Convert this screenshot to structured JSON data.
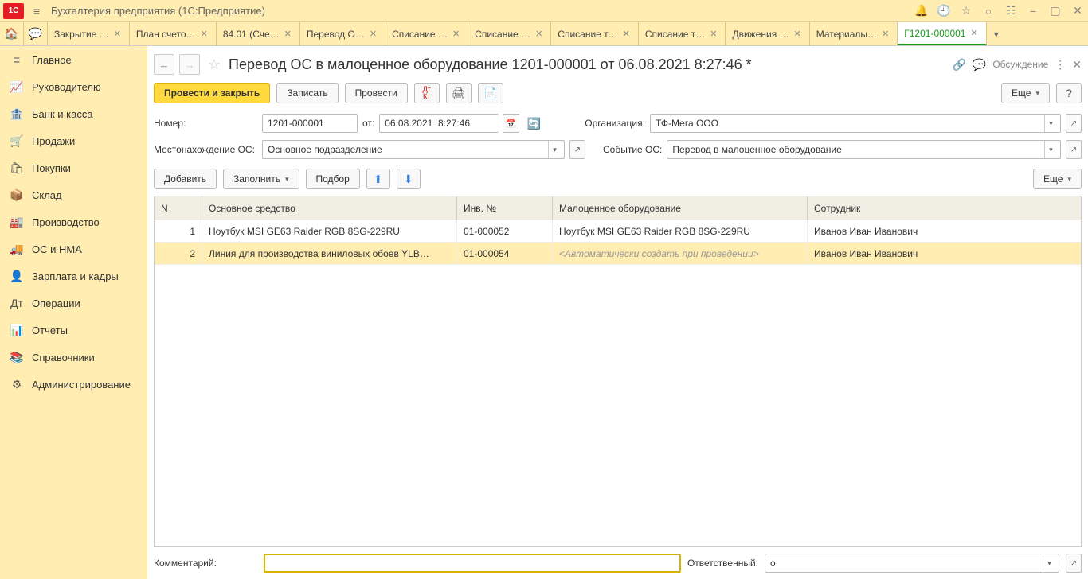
{
  "titlebar": {
    "app_title": "Бухгалтерия предприятия  (1С:Предприятие)"
  },
  "tabs": [
    {
      "label": "Закрытие …"
    },
    {
      "label": "План счето…"
    },
    {
      "label": "84.01 (Сче…"
    },
    {
      "label": "Перевод О…"
    },
    {
      "label": "Списание …"
    },
    {
      "label": "Списание …"
    },
    {
      "label": "Списание т…"
    },
    {
      "label": "Списание т…"
    },
    {
      "label": "Движения …"
    },
    {
      "label": "Материалы…"
    },
    {
      "label": "Г1201-000001",
      "active": true
    }
  ],
  "sidebar": {
    "items": [
      {
        "icon": "≡",
        "label": "Главное"
      },
      {
        "icon": "📈",
        "label": "Руководителю"
      },
      {
        "icon": "🏦",
        "label": "Банк и касса"
      },
      {
        "icon": "🛒",
        "label": "Продажи"
      },
      {
        "icon": "🛍",
        "label": "Покупки"
      },
      {
        "icon": "📦",
        "label": "Склад"
      },
      {
        "icon": "🏭",
        "label": "Производство"
      },
      {
        "icon": "🚚",
        "label": "ОС и НМА"
      },
      {
        "icon": "👤",
        "label": "Зарплата и кадры"
      },
      {
        "icon": "Дт",
        "label": "Операции"
      },
      {
        "icon": "📊",
        "label": "Отчеты"
      },
      {
        "icon": "📚",
        "label": "Справочники"
      },
      {
        "icon": "⚙",
        "label": "Администрирование"
      }
    ]
  },
  "document": {
    "title": "Перевод ОС в малоценное оборудование 1201-000001 от 06.08.2021 8:27:46 *",
    "discuss_label": "Обсуждение",
    "toolbar": {
      "conduct_close": "Провести и закрыть",
      "write": "Записать",
      "conduct": "Провести",
      "more": "Еще"
    },
    "form": {
      "number_label": "Номер:",
      "number_value": "1201-000001",
      "from_label": "от:",
      "date_value": "06.08.2021  8:27:46",
      "org_label": "Организация:",
      "org_value": "ТФ-Мега ООО",
      "location_label": "Местонахождение ОС:",
      "location_value": "Основное подразделение",
      "event_label": "Событие ОС:",
      "event_value": "Перевод в малоценное оборудование"
    },
    "table_toolbar": {
      "add": "Добавить",
      "fill": "Заполнить",
      "select": "Подбор",
      "more": "Еще"
    },
    "table": {
      "headers": {
        "n": "N",
        "asset": "Основное средство",
        "inv": "Инв. №",
        "low_value": "Малоценное оборудование",
        "employee": "Сотрудник"
      },
      "rows": [
        {
          "n": "1",
          "asset": "Ноутбук MSI GE63 Raider RGB 8SG-229RU",
          "inv": "01-000052",
          "low_value": "Ноутбук MSI GE63 Raider RGB 8SG-229RU",
          "employee": "Иванов Иван Иванович"
        },
        {
          "n": "2",
          "asset": "Линия для производства виниловых обоев YLB…",
          "inv": "01-000054",
          "low_value": "<Автоматически создать при проведении>",
          "placeholder": true,
          "employee": "Иванов Иван Иванович",
          "selected": true
        }
      ]
    },
    "footer": {
      "comment_label": "Комментарий:",
      "comment_value": "",
      "responsible_label": "Ответственный:",
      "responsible_value": "о"
    }
  }
}
